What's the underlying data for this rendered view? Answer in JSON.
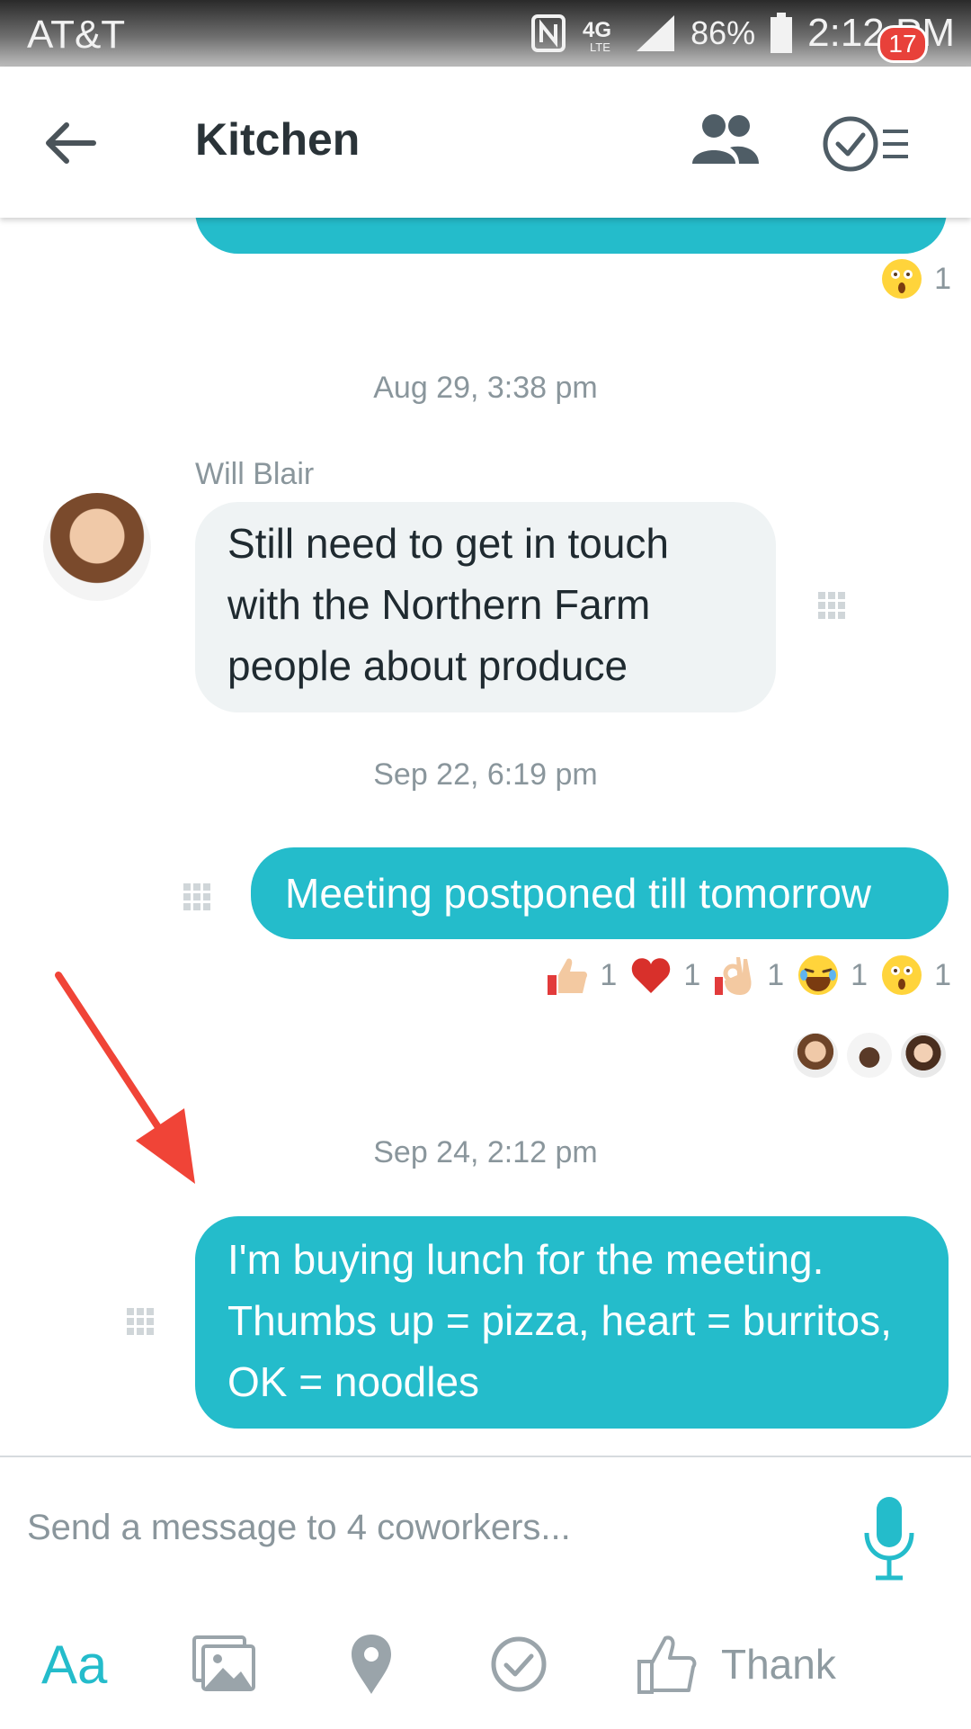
{
  "status_bar": {
    "carrier": "AT&T",
    "network": "4G LTE",
    "battery": "86%",
    "time": "2:12 PM"
  },
  "header": {
    "title": "Kitchen",
    "task_badge": "17"
  },
  "messages": [
    {
      "timestamp": "Aug 29, 3:38 pm",
      "sender": "Will Blair",
      "lines": [
        "Still need to get in touch",
        "with the Northern Farm",
        "people about produce"
      ]
    },
    {
      "timestamp": "Sep 22, 6:19 pm",
      "text": "Meeting postponed till tomorrow",
      "reactions": [
        {
          "icon": "thumbs-up-icon",
          "count": "1"
        },
        {
          "icon": "heart-icon",
          "count": "1"
        },
        {
          "icon": "ok-hand-icon",
          "count": "1"
        },
        {
          "icon": "laughing-face-icon",
          "count": "1"
        },
        {
          "icon": "surprised-face-icon",
          "count": "1"
        }
      ]
    },
    {
      "timestamp": "Sep 24, 2:12 pm",
      "lines": [
        "I'm buying lunch for the meeting.",
        "Thumbs up = pizza, heart = burritos,",
        "OK = noodles"
      ]
    }
  ],
  "top_reaction": {
    "icon": "surprised-face-icon",
    "count": "1"
  },
  "composer": {
    "placeholder": "Send a message to 4 coworkers...",
    "thank_label": "Thank",
    "text_format_label": "Aa"
  },
  "colors": {
    "accent": "#24bccb",
    "badge": "#e8413a",
    "incoming_bubble": "#eff3f4",
    "annotation_arrow": "#f04437"
  }
}
